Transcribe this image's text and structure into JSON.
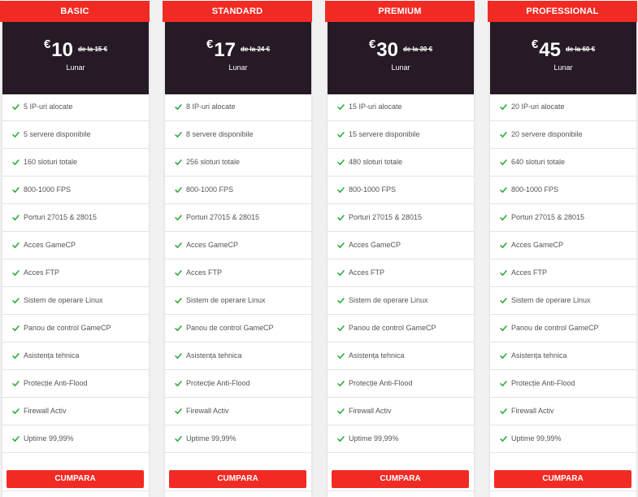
{
  "colors": {
    "accent": "#f12b24",
    "price_bg": "#261a26",
    "check": "#2eae3c"
  },
  "icons": {
    "feature": "check-icon"
  },
  "plans": [
    {
      "name": "BASIC",
      "currency": "€",
      "price": "10",
      "old_price": "de la 15 €",
      "period": "Lunar",
      "features": [
        "5 IP-uri alocate",
        "5 servere disponibile",
        "160 sloturi totale",
        "800-1000 FPS",
        "Porturi 27015 & 28015",
        "Acces GameCP",
        "Acces FTP",
        "Sistem de operare Linux",
        "Panou de control GameCP",
        "Asistența tehnica",
        "Protecție Anti-Flood",
        "Firewall Activ",
        "Uptime 99,99%"
      ],
      "button": "CUMPARA"
    },
    {
      "name": "STANDARD",
      "currency": "€",
      "price": "17",
      "old_price": "de la 24 €",
      "period": "Lunar",
      "features": [
        "8 IP-uri alocate",
        "8 servere disponibile",
        "256 sloturi totale",
        "800-1000 FPS",
        "Porturi 27015 & 28015",
        "Acces GameCP",
        "Acces FTP",
        "Sistem de operare Linux",
        "Panou de control GameCP",
        "Asistența tehnica",
        "Protecție Anti-Flood",
        "Firewall Activ",
        "Uptime 99,99%"
      ],
      "button": "CUMPARA"
    },
    {
      "name": "PREMIUM",
      "currency": "€",
      "price": "30",
      "old_price": "de la 30 €",
      "period": "Lunar",
      "features": [
        "15 IP-uri alocate",
        "15 servere disponibile",
        "480 sloturi totale",
        "800-1000 FPS",
        "Porturi 27015 & 28015",
        "Acces GameCP",
        "Acces FTP",
        "Sistem de operare Linux",
        "Panou de control GameCP",
        "Asistența tehnica",
        "Protecție Anti-Flood",
        "Firewall Activ",
        "Uptime 99,99%"
      ],
      "button": "CUMPARA"
    },
    {
      "name": "PROFESSIONAL",
      "currency": "€",
      "price": "45",
      "old_price": "de la 60 €",
      "period": "Lunar",
      "features": [
        "20 IP-uri alocate",
        "20 servere disponibile",
        "640 sloturi totale",
        "800-1000 FPS",
        "Porturi 27015 & 28015",
        "Acces GameCP",
        "Acces FTP",
        "Sistem de operare Linux",
        "Panou de control GameCP",
        "Asistența tehnica",
        "Protecție Anti-Flood",
        "Firewall Activ",
        "Uptime 99,99%"
      ],
      "button": "CUMPARA"
    }
  ]
}
